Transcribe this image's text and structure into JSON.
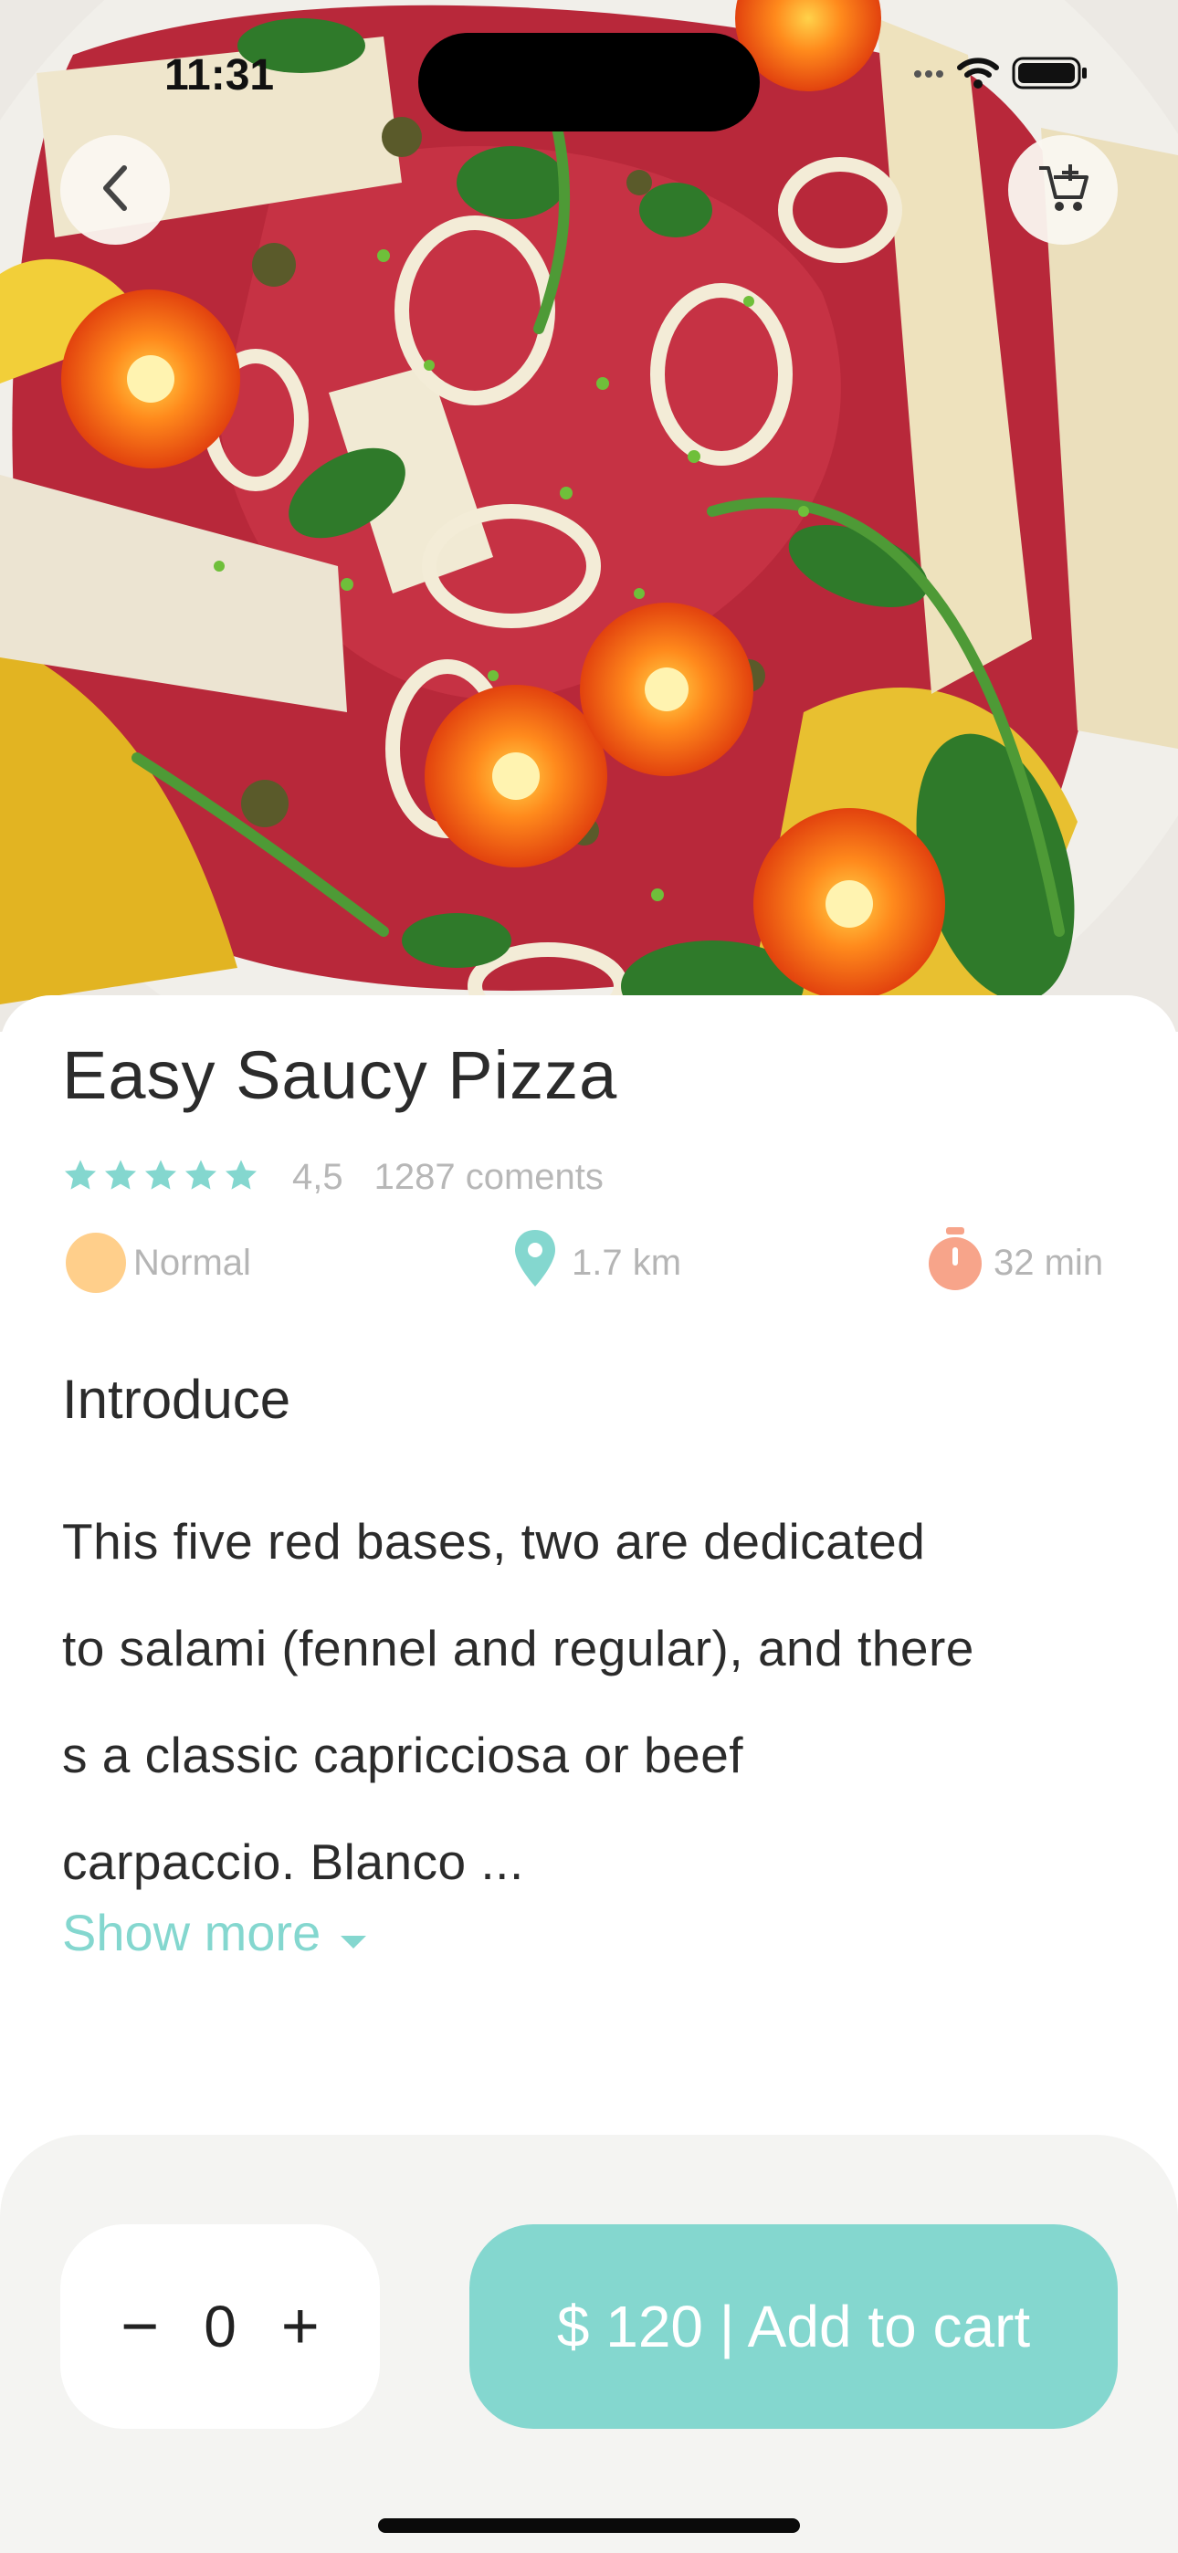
{
  "status": {
    "time": "11:31"
  },
  "hero": {
    "image": "beef carpaccio with tomatoes, parmesan and arugula"
  },
  "header": {
    "back_icon": "chevron-left-icon",
    "cart_icon": "cart-plus-icon"
  },
  "dish": {
    "title": "Easy Saucy Pizza",
    "rating": "4,5",
    "stars": 5,
    "comments": "1287 coments",
    "level": "Normal",
    "distance": "1.7 km",
    "duration": "32 min"
  },
  "intro": {
    "heading": "Introduce",
    "lines": [
      "This five red bases, two are dedicated",
      "to salami (fennel and regular), and there",
      "s a classic capricciosa or beef",
      "carpaccio. Blanco ..."
    ],
    "show_more": "Show more"
  },
  "cart": {
    "minus": "−",
    "quantity": "0",
    "plus": "+",
    "add_label": "$ 120 | Add to cart"
  },
  "colors": {
    "accent": "#84d7cf",
    "level_dot": "#ffcf8b",
    "timer": "#f7a48a",
    "star": "#84d7cf"
  }
}
